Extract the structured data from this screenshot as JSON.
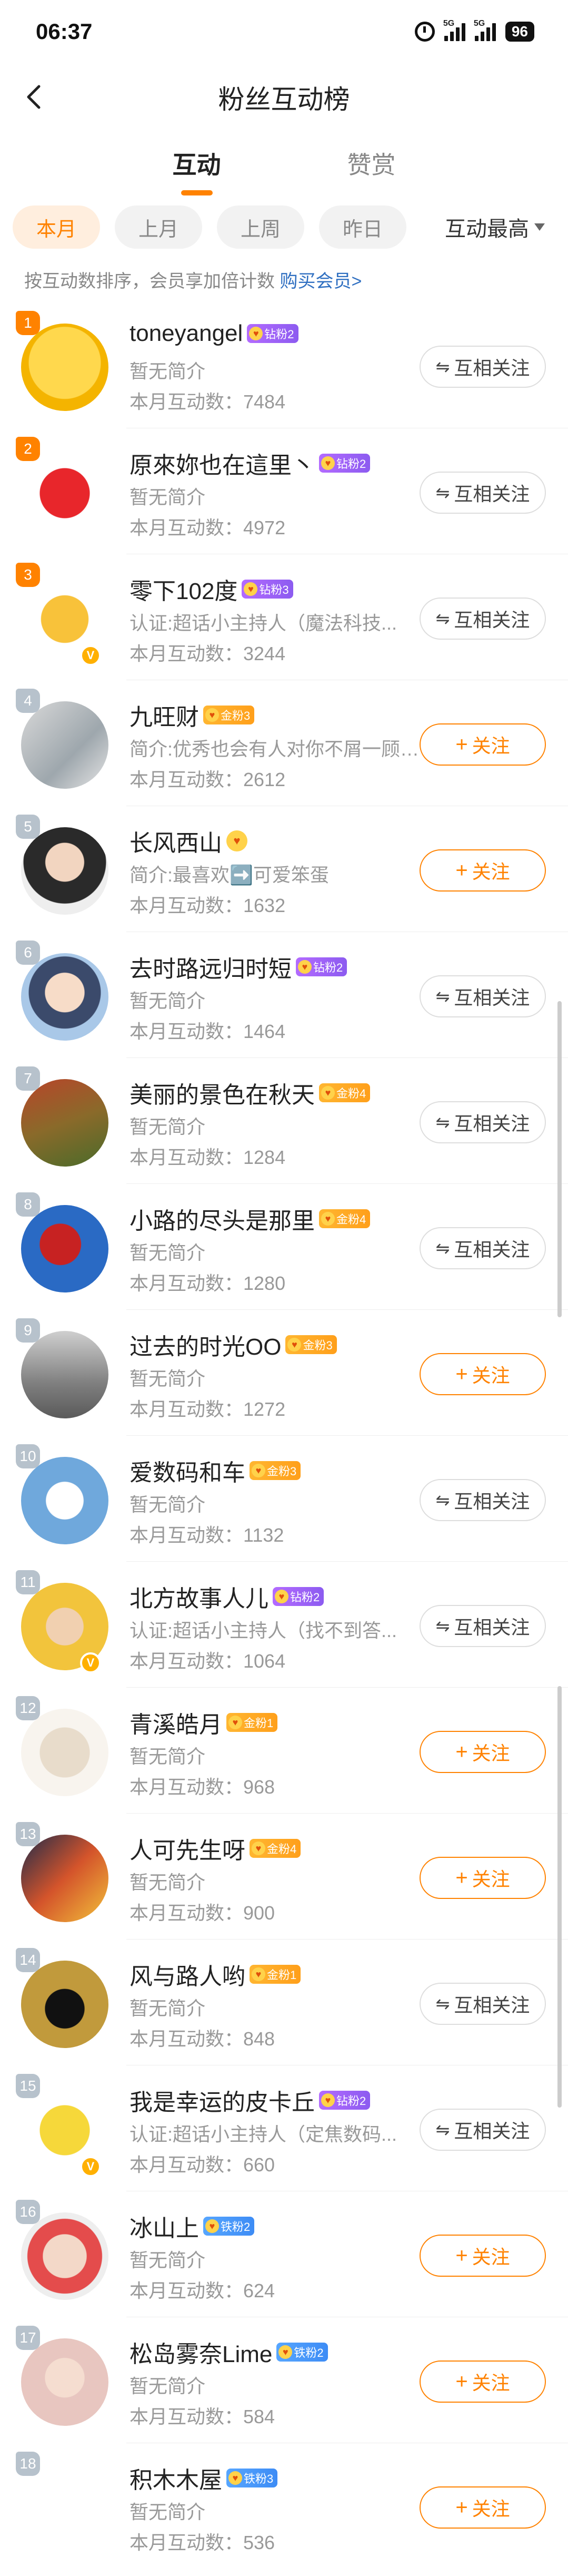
{
  "status_bar": {
    "time": "06:37",
    "battery": "96",
    "signal1": "5G",
    "signal2": "5G"
  },
  "header": {
    "title": "粉丝互动榜"
  },
  "tabs": [
    {
      "label": "互动",
      "active": true
    },
    {
      "label": "赞赏",
      "active": false
    }
  ],
  "filters": {
    "chips": [
      {
        "label": "本月",
        "active": true
      },
      {
        "label": "上月"
      },
      {
        "label": "上周"
      },
      {
        "label": "昨日"
      }
    ],
    "sort_label": "互动最高"
  },
  "notice": {
    "text": "按互动数排序，会员享加倍计数 ",
    "link": "购买会员>"
  },
  "colors": {
    "accent": "#ff8200",
    "link": "#2f6fc1",
    "rank_top": "#ff8200",
    "rank_other": "#b7c2cc"
  },
  "users": [
    {
      "rank": "1",
      "name": "toneyangel",
      "badge": "钻粉2",
      "badge_type": "diamond",
      "intro": "暂无简介",
      "count": "本月互动数：7484",
      "button": "互相关注",
      "btn_type": "mutual",
      "verified": false
    },
    {
      "rank": "2",
      "name": "原來妳也在這里丶",
      "badge": "钻粉2",
      "badge_type": "diamond",
      "intro": "暂无简介",
      "count": "本月互动数：4972",
      "button": "互相关注",
      "btn_type": "mutual",
      "verified": false
    },
    {
      "rank": "3",
      "name": "零下102度",
      "badge": "钻粉3",
      "badge_type": "diamond",
      "intro": "认证:超话小主持人（魔法科技...",
      "count": "本月互动数：3244",
      "button": "互相关注",
      "btn_type": "mutual",
      "verified": true
    },
    {
      "rank": "4",
      "name": "九旺财",
      "badge": "金粉3",
      "badge_type": "gold",
      "intro": "简介:优秀也会有人对你不屑一顾不...",
      "count": "本月互动数：2612",
      "button": "关注",
      "btn_type": "follow",
      "verified": false
    },
    {
      "rank": "5",
      "name": "长风西山",
      "badge": "",
      "badge_type": "only",
      "intro": "简介:最喜欢➡️可爱笨蛋",
      "count": "本月互动数：1632",
      "button": "关注",
      "btn_type": "follow",
      "verified": false
    },
    {
      "rank": "6",
      "name": "去时路远归时短",
      "badge": "钻粉2",
      "badge_type": "diamond",
      "intro": "暂无简介",
      "count": "本月互动数：1464",
      "button": "互相关注",
      "btn_type": "mutual",
      "verified": false
    },
    {
      "rank": "7",
      "name": "美丽的景色在秋天",
      "badge": "金粉4",
      "badge_type": "gold",
      "intro": "暂无简介",
      "count": "本月互动数：1284",
      "button": "互相关注",
      "btn_type": "mutual",
      "verified": false
    },
    {
      "rank": "8",
      "name": "小路的尽头是那里",
      "badge": "金粉4",
      "badge_type": "gold",
      "intro": "暂无简介",
      "count": "本月互动数：1280",
      "button": "互相关注",
      "btn_type": "mutual",
      "verified": false
    },
    {
      "rank": "9",
      "name": "过去的时光OO",
      "badge": "金粉3",
      "badge_type": "gold",
      "intro": "暂无简介",
      "count": "本月互动数：1272",
      "button": "关注",
      "btn_type": "follow",
      "verified": false
    },
    {
      "rank": "10",
      "name": "爱数码和车",
      "badge": "金粉3",
      "badge_type": "gold",
      "intro": "暂无简介",
      "count": "本月互动数：1132",
      "button": "互相关注",
      "btn_type": "mutual",
      "verified": false
    },
    {
      "rank": "11",
      "name": "北方故事人儿",
      "badge": "钻粉2",
      "badge_type": "diamond",
      "intro": "认证:超话小主持人（找不到答...",
      "count": "本月互动数：1064",
      "button": "互相关注",
      "btn_type": "mutual",
      "verified": true
    },
    {
      "rank": "12",
      "name": "青溪皓月",
      "badge": "金粉1",
      "badge_type": "gold",
      "intro": "暂无简介",
      "count": "本月互动数：968",
      "button": "关注",
      "btn_type": "follow",
      "verified": false
    },
    {
      "rank": "13",
      "name": "人可先生呀",
      "badge": "金粉4",
      "badge_type": "gold",
      "intro": "暂无简介",
      "count": "本月互动数：900",
      "button": "关注",
      "btn_type": "follow",
      "verified": false
    },
    {
      "rank": "14",
      "name": "风与路人哟",
      "badge": "金粉1",
      "badge_type": "gold",
      "intro": "暂无简介",
      "count": "本月互动数：848",
      "button": "互相关注",
      "btn_type": "mutual",
      "verified": false
    },
    {
      "rank": "15",
      "name": "我是幸运的皮卡丘",
      "badge": "钻粉2",
      "badge_type": "diamond",
      "intro": "认证:超话小主持人（定焦数码...",
      "count": "本月互动数：660",
      "button": "互相关注",
      "btn_type": "mutual",
      "verified": true
    },
    {
      "rank": "16",
      "name": "冰山上",
      "badge": "铁粉2",
      "badge_type": "iron",
      "intro": "暂无简介",
      "count": "本月互动数：624",
      "button": "关注",
      "btn_type": "follow",
      "verified": false
    },
    {
      "rank": "17",
      "name": "松岛雾奈Lime",
      "badge": "铁粉2",
      "badge_type": "iron",
      "intro": "暂无简介",
      "count": "本月互动数：584",
      "button": "关注",
      "btn_type": "follow",
      "verified": false
    },
    {
      "rank": "18",
      "name": "积木木屋",
      "badge": "铁粉3",
      "badge_type": "iron",
      "intro": "暂无简介",
      "count": "本月互动数：536",
      "button": "关注",
      "btn_type": "follow",
      "verified": false
    }
  ]
}
